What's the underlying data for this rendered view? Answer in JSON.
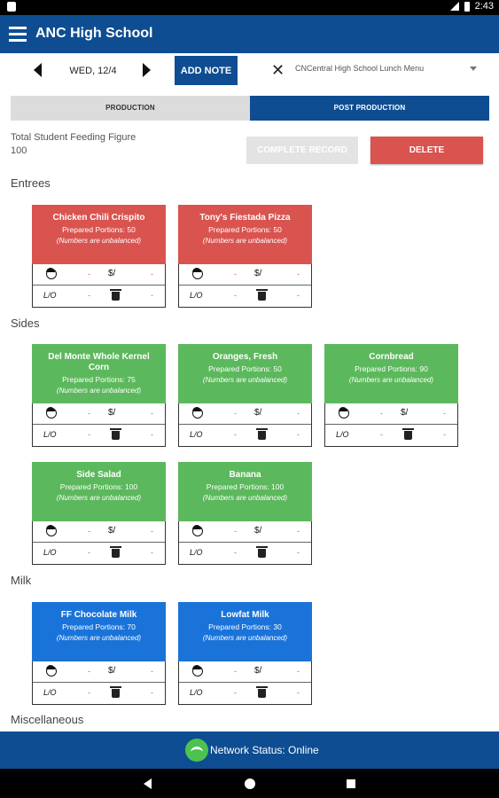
{
  "status": {
    "time": "2:43"
  },
  "app": {
    "title": "ANC High School"
  },
  "date_bar": {
    "date": "WED, 12/4",
    "add_note": "ADD NOTE",
    "menu_name": "CNCentral High School Lunch Menu"
  },
  "tabs": [
    "PRODUCTION",
    "POST PRODUCTION"
  ],
  "feeding": {
    "label": "Total Student Feeding Figure",
    "value": "100"
  },
  "actions": {
    "complete": "COMPLETE RECORD",
    "delete": "DELETE"
  },
  "card_fields": {
    "dollar": "$/",
    "lo": "L/O",
    "dash": "-"
  },
  "sections": {
    "entrees": {
      "title": "Entrees",
      "items": [
        {
          "name": "Chicken Chili Crispito",
          "portions": "Prepared Portions: 50",
          "note": "(Numbers are unbalanced)"
        },
        {
          "name": "Tony's Fiestada Pizza",
          "portions": "Prepared Portions: 50",
          "note": "(Numbers are unbalanced)"
        }
      ]
    },
    "sides": {
      "title": "Sides",
      "items": [
        {
          "name": "Del Monte Whole Kernel Corn",
          "portions": "Prepared Portions: 75",
          "note": "(Numbers are unbalanced)"
        },
        {
          "name": "Oranges, Fresh",
          "portions": "Prepared Portions: 50",
          "note": "(Numbers are unbalanced)"
        },
        {
          "name": "Cornbread",
          "portions": "Prepared Portions: 90",
          "note": "(Numbers are unbalanced)"
        },
        {
          "name": "Side Salad",
          "portions": "Prepared Portions: 100",
          "note": "(Numbers are unbalanced)"
        },
        {
          "name": "Banana",
          "portions": "Prepared Portions: 100",
          "note": "(Numbers are unbalanced)"
        }
      ]
    },
    "milk": {
      "title": "Milk",
      "items": [
        {
          "name": "FF Chocolate Milk",
          "portions": "Prepared Portions: 70",
          "note": "(Numbers are unbalanced)"
        },
        {
          "name": "Lowfat Milk",
          "portions": "Prepared Portions: 30",
          "note": "(Numbers are unbalanced)"
        }
      ]
    },
    "misc": {
      "title": "Miscellaneous"
    }
  },
  "network": {
    "label": "Network Status:",
    "status": "Online"
  },
  "colors": {
    "primary": "#0e4d92",
    "entree": "#d9534f",
    "side": "#5cb85c",
    "milk": "#1a73d9",
    "online": "#4cc34e"
  }
}
